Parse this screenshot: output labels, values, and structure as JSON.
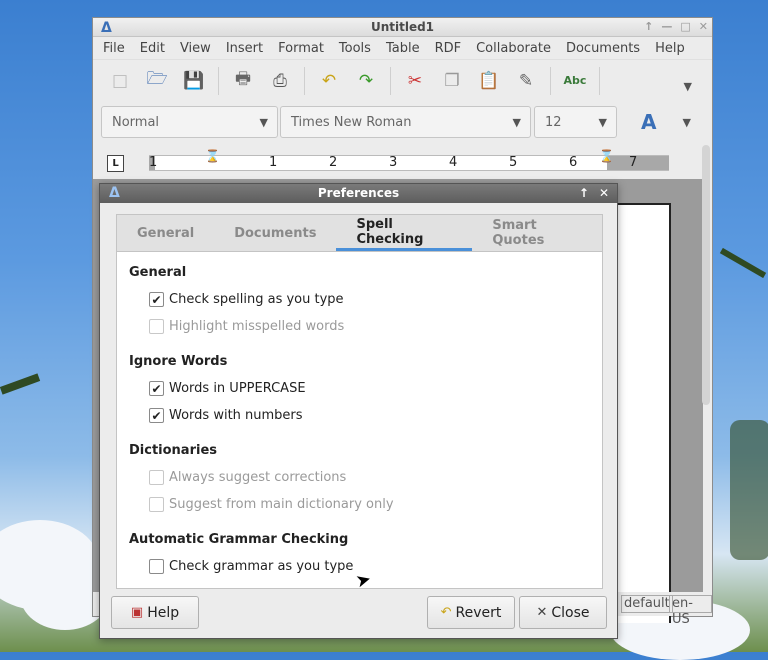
{
  "window": {
    "title": "Untitled1",
    "menu": [
      "File",
      "Edit",
      "View",
      "Insert",
      "Format",
      "Tools",
      "Table",
      "RDF",
      "Collaborate",
      "Documents",
      "Help"
    ]
  },
  "formatbar": {
    "style": "Normal",
    "font": "Times New Roman",
    "size": "12"
  },
  "ruler": {
    "numbers": [
      "1",
      "1",
      "2",
      "3",
      "4",
      "5",
      "6",
      "7"
    ]
  },
  "statusbar": {
    "language_mode": "default",
    "locale": "en-US"
  },
  "dialog": {
    "title": "Preferences",
    "tabs": [
      "General",
      "Documents",
      "Spell Checking",
      "Smart Quotes"
    ],
    "active_tab": "Spell Checking",
    "sections": [
      {
        "heading": "General",
        "options": [
          {
            "label": "Check spelling as you type",
            "checked": true,
            "enabled": true
          },
          {
            "label": "Highlight misspelled words",
            "checked": false,
            "enabled": false
          }
        ]
      },
      {
        "heading": "Ignore Words",
        "options": [
          {
            "label": "Words in UPPERCASE",
            "checked": true,
            "enabled": true
          },
          {
            "label": "Words with numbers",
            "checked": true,
            "enabled": true
          }
        ]
      },
      {
        "heading": "Dictionaries",
        "options": [
          {
            "label": "Always suggest corrections",
            "checked": false,
            "enabled": false
          },
          {
            "label": "Suggest from main dictionary only",
            "checked": false,
            "enabled": false
          }
        ]
      },
      {
        "heading": "Automatic Grammar Checking",
        "options": [
          {
            "label": "Check grammar as you type",
            "checked": false,
            "enabled": true
          }
        ]
      }
    ],
    "buttons": {
      "help": "Help",
      "revert": "Revert",
      "close": "Close"
    }
  },
  "colors": {
    "accent": "#4a90d9",
    "dialog_title_bg": "#666666"
  }
}
